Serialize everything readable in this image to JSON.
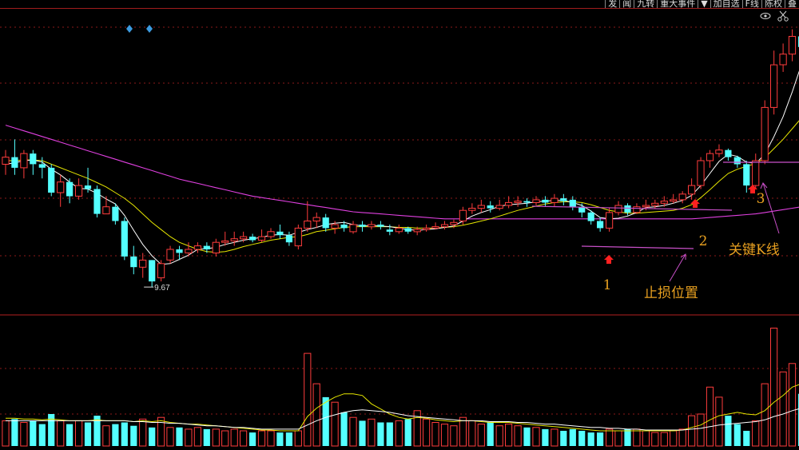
{
  "toolbar": {
    "items": [
      "发",
      "闻",
      "九转",
      "重大事件",
      "▼",
      "加自选",
      "F线",
      "陈权",
      "叠"
    ]
  },
  "chart_data": {
    "type": "candlestick",
    "ma_colors": {
      "ma5": "#ffffff",
      "ma10": "#e6e600",
      "ma60": "#e040e0"
    },
    "up_color": "#ff3c3c",
    "down_color": "#54ffff",
    "low_label": "9.67",
    "candles": [
      [
        11.4,
        11.5,
        11.6,
        11.25
      ],
      [
        11.5,
        11.35,
        11.75,
        11.25
      ],
      [
        11.35,
        11.55,
        11.6,
        11.2
      ],
      [
        11.55,
        11.4,
        11.6,
        11.25
      ],
      [
        11.4,
        11.35,
        11.5,
        11.2
      ],
      [
        11.35,
        11.0,
        11.4,
        10.95
      ],
      [
        11.0,
        11.15,
        11.25,
        10.8
      ],
      [
        11.15,
        10.95,
        11.2,
        10.85
      ],
      [
        10.95,
        11.1,
        11.2,
        10.9
      ],
      [
        11.1,
        11.05,
        11.35,
        11.0
      ],
      [
        11.05,
        10.7,
        11.1,
        10.65
      ],
      [
        10.7,
        10.8,
        10.95,
        10.7
      ],
      [
        10.8,
        10.6,
        10.85,
        10.55
      ],
      [
        10.6,
        10.1,
        10.65,
        10.05
      ],
      [
        10.1,
        9.95,
        10.25,
        9.85
      ],
      [
        9.95,
        10.05,
        10.15,
        9.8
      ],
      [
        10.05,
        9.75,
        10.05,
        9.67
      ],
      [
        9.8,
        10.0,
        10.05,
        9.75
      ],
      [
        10.05,
        10.2,
        10.25,
        10.0
      ],
      [
        10.2,
        10.15,
        10.25,
        10.05
      ],
      [
        10.15,
        10.2,
        10.3,
        10.1
      ],
      [
        10.2,
        10.25,
        10.3,
        10.15
      ],
      [
        10.25,
        10.2,
        10.3,
        10.15
      ],
      [
        10.15,
        10.3,
        10.35,
        10.1
      ],
      [
        10.3,
        10.32,
        10.45,
        10.25
      ],
      [
        10.32,
        10.35,
        10.45,
        10.25
      ],
      [
        10.35,
        10.38,
        10.45,
        10.3
      ],
      [
        10.38,
        10.33,
        10.42,
        10.3
      ],
      [
        10.33,
        10.38,
        10.48,
        10.3
      ],
      [
        10.38,
        10.45,
        10.5,
        10.35
      ],
      [
        10.45,
        10.4,
        10.55,
        10.35
      ],
      [
        10.4,
        10.3,
        10.45,
        10.25
      ],
      [
        10.25,
        10.5,
        10.55,
        10.2
      ],
      [
        10.5,
        10.6,
        10.88,
        10.45
      ],
      [
        10.6,
        10.65,
        10.72,
        10.5
      ],
      [
        10.65,
        10.5,
        10.7,
        10.45
      ],
      [
        10.5,
        10.55,
        10.6,
        10.42
      ],
      [
        10.55,
        10.5,
        10.6,
        10.45
      ],
      [
        10.45,
        10.55,
        10.6,
        10.42
      ],
      [
        10.55,
        10.52,
        10.6,
        10.45
      ],
      [
        10.52,
        10.55,
        10.6,
        10.48
      ],
      [
        10.55,
        10.52,
        10.6,
        10.48
      ],
      [
        10.48,
        10.45,
        10.55,
        10.4
      ],
      [
        10.45,
        10.5,
        10.55,
        10.42
      ],
      [
        10.5,
        10.45,
        10.52,
        10.42
      ],
      [
        10.45,
        10.48,
        10.52,
        10.4
      ],
      [
        10.48,
        10.5,
        10.55,
        10.45
      ],
      [
        10.5,
        10.52,
        10.58,
        10.48
      ],
      [
        10.52,
        10.55,
        10.6,
        10.48
      ],
      [
        10.55,
        10.58,
        10.62,
        10.5
      ],
      [
        10.6,
        10.75,
        10.8,
        10.55
      ],
      [
        10.75,
        10.78,
        10.85,
        10.7
      ],
      [
        10.78,
        10.82,
        10.9,
        10.72
      ],
      [
        10.82,
        10.78,
        10.88,
        10.72
      ],
      [
        10.78,
        10.82,
        10.9,
        10.75
      ],
      [
        10.82,
        10.86,
        10.95,
        10.78
      ],
      [
        10.86,
        10.88,
        10.95,
        10.8
      ],
      [
        10.88,
        10.86,
        10.92,
        10.8
      ],
      [
        10.86,
        10.9,
        10.95,
        10.82
      ],
      [
        10.9,
        10.86,
        10.95,
        10.8
      ],
      [
        10.86,
        10.92,
        10.98,
        10.8
      ],
      [
        10.92,
        10.88,
        10.98,
        10.82
      ],
      [
        10.9,
        10.8,
        10.95,
        10.75
      ],
      [
        10.8,
        10.72,
        10.85,
        10.65
      ],
      [
        10.72,
        10.6,
        10.75,
        10.55
      ],
      [
        10.6,
        10.5,
        10.65,
        10.45
      ],
      [
        10.5,
        10.72,
        10.78,
        10.45
      ],
      [
        10.72,
        10.82,
        10.88,
        10.68
      ],
      [
        10.82,
        10.72,
        10.85,
        10.68
      ],
      [
        10.72,
        10.8,
        10.85,
        10.7
      ],
      [
        10.8,
        10.82,
        10.9,
        10.75
      ],
      [
        10.82,
        10.85,
        10.9,
        10.78
      ],
      [
        10.85,
        10.88,
        10.95,
        10.8
      ],
      [
        10.88,
        10.9,
        10.98,
        10.85
      ],
      [
        10.9,
        10.98,
        11.02,
        10.85
      ],
      [
        10.98,
        11.1,
        11.2,
        10.9
      ],
      [
        11.1,
        11.45,
        11.5,
        11.05
      ],
      [
        11.45,
        11.55,
        11.6,
        11.35
      ],
      [
        11.55,
        11.6,
        11.68,
        11.5
      ],
      [
        11.6,
        11.5,
        11.62,
        11.45
      ],
      [
        11.5,
        11.4,
        11.52,
        11.35
      ],
      [
        11.4,
        11.1,
        11.45,
        11.0
      ],
      [
        11.1,
        11.45,
        11.55,
        11.05
      ],
      [
        11.45,
        12.2,
        12.3,
        11.4
      ],
      [
        12.2,
        12.8,
        13.0,
        12.1
      ],
      [
        12.8,
        12.95,
        13.1,
        12.7
      ],
      [
        12.95,
        13.2,
        13.3,
        12.85
      ],
      [
        13.2,
        13.05,
        13.35,
        12.95
      ]
    ],
    "ma5": [
      11.4,
      11.42,
      11.45,
      11.46,
      11.43,
      11.33,
      11.25,
      11.15,
      11.06,
      11.05,
      10.99,
      10.91,
      10.84,
      10.68,
      10.47,
      10.27,
      10.11,
      9.99,
      10.0,
      10.06,
      10.12,
      10.2,
      10.21,
      10.23,
      10.27,
      10.3,
      10.33,
      10.35,
      10.37,
      10.4,
      10.41,
      10.4,
      10.44,
      10.48,
      10.51,
      10.55,
      10.57,
      10.58,
      10.55,
      10.53,
      10.54,
      10.53,
      10.52,
      10.5,
      10.48,
      10.47,
      10.48,
      10.49,
      10.51,
      10.53,
      10.6,
      10.67,
      10.72,
      10.76,
      10.81,
      10.83,
      10.84,
      10.85,
      10.87,
      10.88,
      10.89,
      10.89,
      10.86,
      10.82,
      10.74,
      10.65,
      10.63,
      10.64,
      10.67,
      10.72,
      10.79,
      10.8,
      10.82,
      10.85,
      10.89,
      10.96,
      11.1,
      11.27,
      11.44,
      11.54,
      11.51,
      11.43,
      11.41,
      11.54,
      11.79,
      12.07,
      12.42,
      12.8
    ],
    "ma10": [
      11.45,
      11.45,
      11.46,
      11.46,
      11.45,
      11.4,
      11.35,
      11.3,
      11.25,
      11.2,
      11.14,
      11.08,
      11.0,
      10.92,
      10.82,
      10.7,
      10.58,
      10.48,
      10.38,
      10.3,
      10.25,
      10.2,
      10.17,
      10.16,
      10.17,
      10.2,
      10.24,
      10.27,
      10.3,
      10.33,
      10.35,
      10.37,
      10.38,
      10.41,
      10.45,
      10.47,
      10.49,
      10.51,
      10.52,
      10.52,
      10.52,
      10.52,
      10.52,
      10.51,
      10.51,
      10.5,
      10.5,
      10.5,
      10.51,
      10.52,
      10.54,
      10.57,
      10.6,
      10.63,
      10.67,
      10.71,
      10.75,
      10.78,
      10.81,
      10.84,
      10.86,
      10.87,
      10.87,
      10.86,
      10.83,
      10.79,
      10.75,
      10.73,
      10.71,
      10.71,
      10.72,
      10.73,
      10.74,
      10.75,
      10.78,
      10.83,
      10.93,
      11.04,
      11.16,
      11.27,
      11.33,
      11.37,
      11.41,
      11.49,
      11.62,
      11.75,
      11.9,
      12.05
    ],
    "ma60": [
      11.95,
      11.91,
      11.87,
      11.83,
      11.79,
      11.75,
      11.71,
      11.67,
      11.63,
      11.59,
      11.55,
      11.51,
      11.47,
      11.43,
      11.39,
      11.35,
      11.31,
      11.27,
      11.23,
      11.19,
      11.16,
      11.13,
      11.1,
      11.07,
      11.04,
      11.01,
      10.98,
      10.95,
      10.93,
      10.91,
      10.89,
      10.87,
      10.85,
      10.83,
      10.81,
      10.79,
      10.77,
      10.75,
      10.73,
      10.72,
      10.71,
      10.7,
      10.69,
      10.68,
      10.67,
      10.66,
      10.65,
      10.64,
      10.63,
      10.63,
      10.63,
      10.63,
      10.63,
      10.63,
      10.63,
      10.63,
      10.63,
      10.63,
      10.63,
      10.63,
      10.63,
      10.63,
      10.63,
      10.63,
      10.63,
      10.63,
      10.63,
      10.63,
      10.63,
      10.63,
      10.63,
      10.63,
      10.63,
      10.63,
      10.63,
      10.63,
      10.64,
      10.65,
      10.66,
      10.67,
      10.68,
      10.69,
      10.7,
      10.72,
      10.74,
      10.76,
      10.78,
      10.8
    ],
    "volume": [
      30,
      32,
      28,
      30,
      26,
      38,
      30,
      26,
      30,
      28,
      36,
      24,
      26,
      28,
      24,
      32,
      22,
      34,
      22,
      22,
      20,
      22,
      20,
      20,
      18,
      20,
      18,
      16,
      18,
      18,
      16,
      16,
      18,
      110,
      74,
      58,
      52,
      40,
      34,
      30,
      32,
      28,
      28,
      30,
      32,
      42,
      32,
      28,
      26,
      24,
      34,
      30,
      26,
      28,
      24,
      26,
      24,
      22,
      22,
      20,
      20,
      18,
      20,
      18,
      16,
      16,
      20,
      18,
      20,
      20,
      18,
      16,
      16,
      18,
      20,
      36,
      38,
      70,
      58,
      36,
      26,
      18,
      30,
      74,
      140,
      88,
      98,
      62
    ],
    "vol_ma1": [
      33,
      33,
      32,
      32,
      31,
      32,
      31,
      30,
      30,
      30,
      31,
      30,
      30,
      30,
      29,
      30,
      29,
      30,
      28,
      27,
      26,
      26,
      25,
      24,
      23,
      22,
      21,
      20,
      19,
      19,
      18,
      18,
      18,
      35,
      45,
      52,
      58,
      62,
      62,
      60,
      50,
      44,
      38,
      34,
      32,
      34,
      33,
      31,
      30,
      29,
      30,
      30,
      29,
      28,
      28,
      28,
      27,
      26,
      25,
      24,
      23,
      22,
      21,
      20,
      19,
      18,
      18,
      18,
      18,
      18,
      18,
      18,
      18,
      18,
      19,
      22,
      25,
      31,
      36,
      38,
      40,
      38,
      37,
      42,
      52,
      60,
      70,
      74
    ],
    "vol_ma2": [
      30,
      30,
      30,
      30,
      30,
      30,
      30,
      30,
      30,
      30,
      30,
      30,
      30,
      30,
      29,
      29,
      28,
      28,
      27,
      27,
      26,
      25,
      24,
      24,
      23,
      22,
      22,
      21,
      20,
      20,
      20,
      20,
      20,
      25,
      30,
      34,
      37,
      40,
      42,
      43,
      42,
      41,
      40,
      38,
      36,
      35,
      34,
      33,
      32,
      31,
      30,
      30,
      30,
      29,
      29,
      29,
      28,
      28,
      27,
      26,
      26,
      25,
      24,
      23,
      22,
      22,
      21,
      21,
      20,
      20,
      19,
      19,
      19,
      19,
      19,
      20,
      21,
      23,
      25,
      26,
      27,
      28,
      29,
      31,
      35,
      38,
      42,
      45
    ],
    "ranges": {
      "price": [
        9.3,
        13.6
      ],
      "volume": [
        0,
        150
      ]
    }
  },
  "annotations": {
    "label1": "1",
    "label2": "2",
    "label3": "3",
    "stop_loss": "止损位置",
    "key_candle": "关键K线"
  }
}
